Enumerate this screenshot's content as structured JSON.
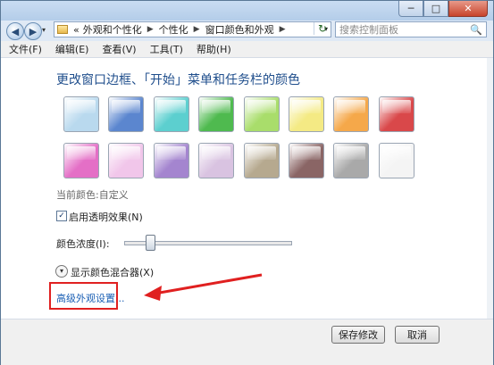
{
  "window": {
    "controls": {
      "minimize": "─",
      "maximize": "□",
      "close": "✕"
    }
  },
  "nav": {
    "back": "◀",
    "forward": "▶",
    "dropdown": "▾",
    "overflow": "«",
    "breadcrumbs": [
      "外观和个性化",
      "个性化",
      "窗口颜色和外观"
    ],
    "separator": "▶",
    "address_dropdown": "▾",
    "refresh": "↻",
    "search_placeholder": "搜索控制面板",
    "search_icon": "🔍"
  },
  "menu": [
    "文件(F)",
    "编辑(E)",
    "查看(V)",
    "工具(T)",
    "帮助(H)"
  ],
  "main": {
    "heading": "更改窗口边框、「开始」菜单和任务栏的颜色",
    "swatches": [
      {
        "name": "sky",
        "color": "#b9d9ee"
      },
      {
        "name": "twilight",
        "color": "#5b86cf"
      },
      {
        "name": "sea",
        "color": "#5ccfcf"
      },
      {
        "name": "leaf",
        "color": "#4fba4f"
      },
      {
        "name": "lime",
        "color": "#a9dd6b"
      },
      {
        "name": "lemon",
        "color": "#f4ea84"
      },
      {
        "name": "pumpkin",
        "color": "#f5a84a"
      },
      {
        "name": "ruby",
        "color": "#d9484a"
      },
      {
        "name": "fuchsia",
        "color": "#e46fc6"
      },
      {
        "name": "blush",
        "color": "#f1c6ea"
      },
      {
        "name": "violet",
        "color": "#a485cf"
      },
      {
        "name": "lavender",
        "color": "#d9c3e1"
      },
      {
        "name": "taupe",
        "color": "#b6a98f"
      },
      {
        "name": "chocolate",
        "color": "#8a6565"
      },
      {
        "name": "slate",
        "color": "#a9a9a9"
      },
      {
        "name": "frost",
        "color": "#f4f4f4"
      }
    ],
    "current_color_label": "当前颜色:",
    "current_color_value": "自定义",
    "transparency_label": "启用透明效果(N)",
    "transparency_checked": true,
    "intensity_label": "颜色浓度(I):",
    "intensity_value": 0.15,
    "mixer_label": "显示颜色混合器(X)",
    "advanced_link": "高级外观设置..."
  },
  "footer": {
    "save": "保存修改",
    "cancel": "取消"
  },
  "colors": {
    "annotation_red": "#e02020",
    "link_blue": "#1a5fb4",
    "heading_blue": "#1f4e8c"
  }
}
